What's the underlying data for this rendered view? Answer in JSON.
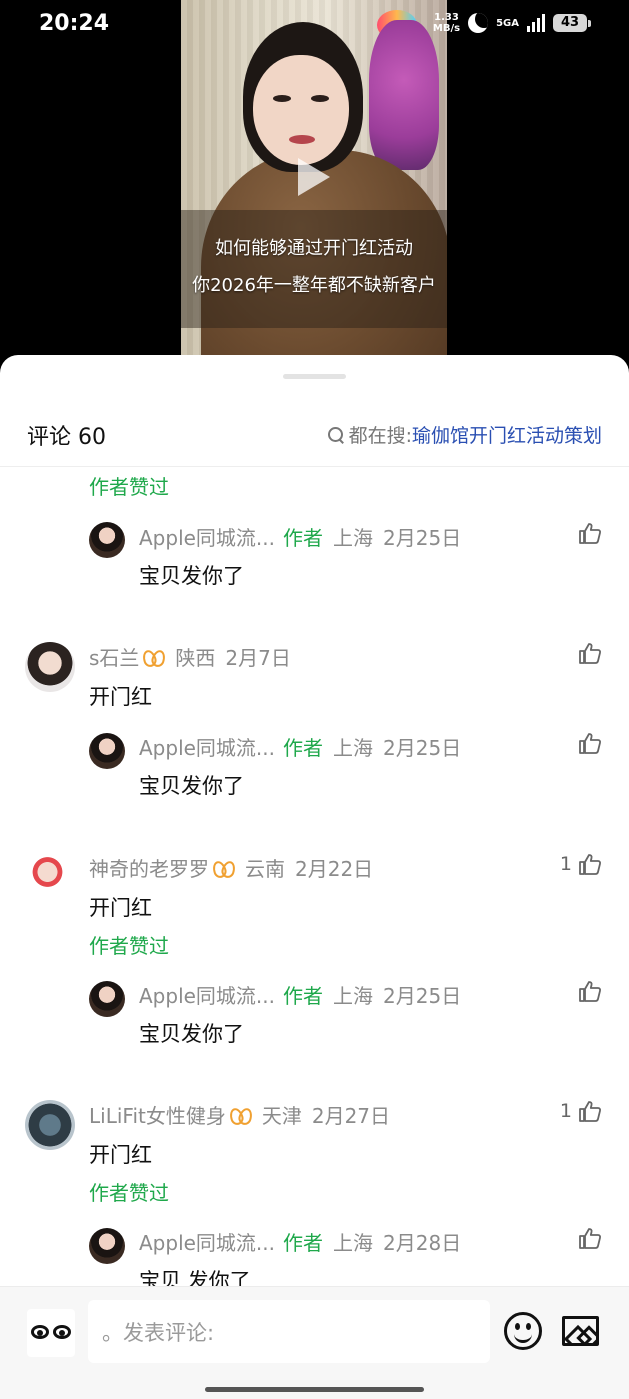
{
  "status_bar": {
    "time": "20:24",
    "net_speed_value": "1.33",
    "net_speed_unit": "MB/s",
    "network": "5GA",
    "battery": "43"
  },
  "video": {
    "caption_line1": "如何能够通过开门红活动",
    "caption_line2": "你2026年一整年都不缺新客户"
  },
  "sheet": {
    "title": "评论 60",
    "search_prefix": "都在搜: ",
    "search_term": "瑜伽馆开门红活动策划"
  },
  "comments": [
    {
      "liked_by_author": "作者赞过",
      "reply": {
        "user": "Apple同城流...",
        "author_tag": "作者",
        "location": "上海",
        "date": "2月25日",
        "text": "宝贝发你了"
      }
    },
    {
      "user": "s石兰",
      "location": "陕西",
      "date": "2月7日",
      "text": "开门红",
      "likes": "",
      "reply": {
        "user": "Apple同城流...",
        "author_tag": "作者",
        "location": "上海",
        "date": "2月25日",
        "text": "宝贝发你了"
      }
    },
    {
      "user": "神奇的老罗罗",
      "location": "云南",
      "date": "2月22日",
      "text": "开门红",
      "likes": "1",
      "liked_by_author": "作者赞过",
      "reply": {
        "user": "Apple同城流...",
        "author_tag": "作者",
        "location": "上海",
        "date": "2月25日",
        "text": "宝贝发你了"
      }
    },
    {
      "user": "LiLiFit女性健身",
      "location": "天津",
      "date": "2月27日",
      "text": "开门红",
      "likes": "1",
      "liked_by_author": "作者赞过",
      "reply": {
        "user": "Apple同城流...",
        "author_tag": "作者",
        "location": "上海",
        "date": "2月28日",
        "text": "宝贝 发你了"
      }
    }
  ],
  "input": {
    "placeholder": "。发表评论:"
  },
  "icons": {
    "like": "thumbs-up-icon",
    "search": "search-icon",
    "sticker": "sticker-eyes-icon",
    "emoji": "emoji-smile-icon",
    "image": "image-icon",
    "badge": "vip-badge-icon"
  },
  "colors": {
    "author_green": "#1fa84b",
    "search_term_blue": "#2a4fb2",
    "badge_orange": "#f0a030"
  }
}
